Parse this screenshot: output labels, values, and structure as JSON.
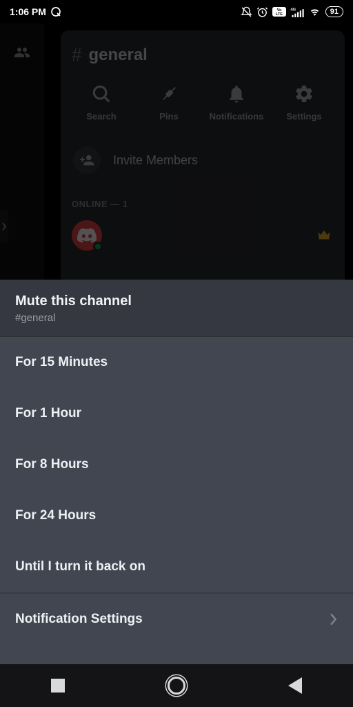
{
  "status_bar": {
    "time": "1:06 PM",
    "battery": "91"
  },
  "channel": {
    "hash": "#",
    "name": "general"
  },
  "actions": {
    "search": "Search",
    "pins": "Pins",
    "notifications": "Notifications",
    "settings": "Settings"
  },
  "invite": {
    "label": "Invite Members"
  },
  "online": {
    "label": "ONLINE — 1"
  },
  "mute": {
    "title": "Mute this channel",
    "subtitle": "#general",
    "options": {
      "o1": "For 15 Minutes",
      "o2": "For 1 Hour",
      "o3": "For 8 Hours",
      "o4": "For 24 Hours",
      "o5": "Until I turn it back on"
    },
    "settings": "Notification Settings"
  }
}
